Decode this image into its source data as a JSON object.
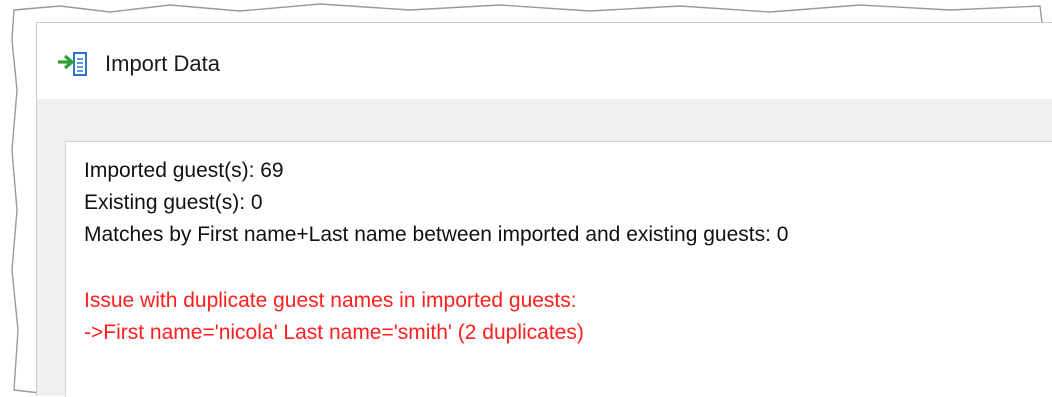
{
  "window": {
    "title": "Import Data",
    "icon": "import-data-icon"
  },
  "results": {
    "imported": "Imported guest(s): 69",
    "existing": "Existing guest(s): 0",
    "matches": "Matches by First name+Last name between imported and existing guests: 0"
  },
  "issues": {
    "heading": "Issue with duplicate guest names in imported guests:",
    "items": [
      "->First name='nicola' Last name='smith' (2 duplicates)"
    ]
  },
  "colors": {
    "error_text": "#ff1f1f",
    "icon_arrow": "#2e9e3a",
    "icon_doc": "#2b79c2"
  }
}
